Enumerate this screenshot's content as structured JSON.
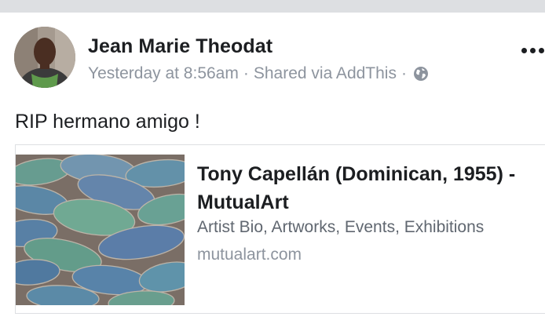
{
  "post": {
    "author": "Jean Marie Theodat",
    "time": "Yesterday at 8:56am",
    "separator": "·",
    "shared_via": "Shared via AddThis",
    "audience_icon": "globe-icon",
    "more_icon": "more-options-icon",
    "text": "RIP hermano amigo !"
  },
  "link_preview": {
    "title": "Tony Capellán (Dominican, 1955) - MutualArt",
    "description": "Artist Bio, Artworks, Events, Exhibitions",
    "domain": "mutualart.com",
    "image_subject": "blue and green flip-flops"
  },
  "colors": {
    "top_bar": "#dddfe2",
    "secondary_text": "#8d949e",
    "description_text": "#606770"
  }
}
